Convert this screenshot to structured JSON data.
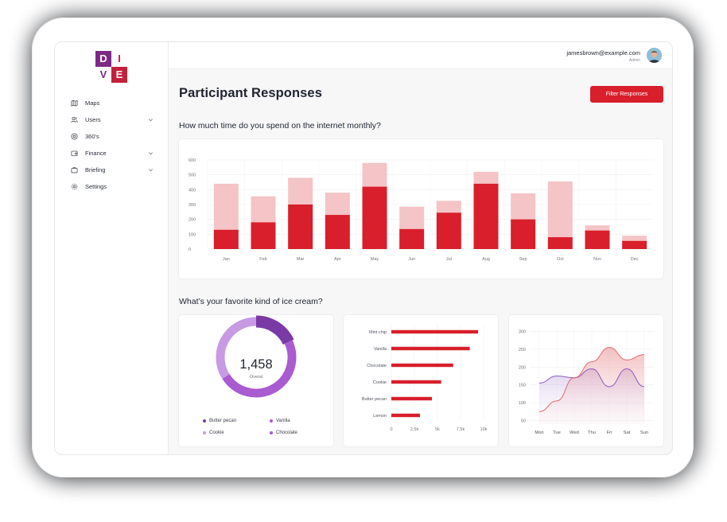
{
  "app": {
    "logo": {
      "letters": [
        "D",
        "I",
        "V",
        "E"
      ]
    }
  },
  "sidebar": {
    "items": [
      {
        "label": "Maps",
        "icon": "map-icon",
        "has_chevron": false
      },
      {
        "label": "Users",
        "icon": "users-icon",
        "has_chevron": true
      },
      {
        "label": "360's",
        "icon": "target-icon",
        "has_chevron": false
      },
      {
        "label": "Finance",
        "icon": "wallet-icon",
        "has_chevron": true
      },
      {
        "label": "Briefing",
        "icon": "briefcase-icon",
        "has_chevron": true
      },
      {
        "label": "Settings",
        "icon": "gear-icon",
        "has_chevron": false
      }
    ]
  },
  "header": {
    "email": "jamesbrown@example.com",
    "role": "Admin"
  },
  "main": {
    "title": "Participant Responses",
    "filter_label": "Filter Responses",
    "question1": "How much time do you spend on the internet monthly?",
    "question2": "What’s your favorite kind of ice cream?"
  },
  "colors": {
    "accent": "#d81f2b",
    "accent_light": "#f4c4c6",
    "purple_dark": "#7a3aa6",
    "purple_mid": "#a95bd0",
    "purple_light": "#c79ae3",
    "line_red": "#e06a70",
    "line_purple": "#8c5cb8"
  },
  "chart_data": [
    {
      "type": "bar",
      "stacked": true,
      "categories": [
        "Jan",
        "Feb",
        "Mar",
        "Apr",
        "May",
        "Jun",
        "Jul",
        "Aug",
        "Sep",
        "Oct",
        "Nov",
        "Dec"
      ],
      "series": [
        {
          "values": [
            130,
            180,
            300,
            230,
            420,
            135,
            245,
            440,
            200,
            80,
            125,
            55
          ]
        },
        {
          "values": [
            310,
            175,
            180,
            150,
            160,
            150,
            80,
            80,
            175,
            375,
            35,
            35
          ]
        }
      ],
      "yticks": [
        0,
        100,
        200,
        300,
        400,
        500,
        600
      ],
      "ylim": [
        0,
        600
      ],
      "grid": true
    },
    {
      "type": "pie",
      "donut": true,
      "total": "1,458",
      "center_label": "Overal",
      "slices": [
        {
          "name": "Butter pecan",
          "value": 18
        },
        {
          "name": "Vanilla",
          "value": 48
        },
        {
          "name": "Cookie",
          "value": 34
        }
      ],
      "legend": [
        "Butter pecan",
        "Vanilla",
        "Cookie",
        "Chocolate"
      ]
    },
    {
      "type": "bar",
      "orientation": "horizontal",
      "categories": [
        "Mint chip",
        "Vanilla",
        "Chocolate",
        "Cookie",
        "Butter pecan",
        "Lemon"
      ],
      "values": [
        9400,
        8500,
        6700,
        5400,
        4400,
        3100
      ],
      "xticks": [
        "0",
        "2,5k",
        "5k",
        "7,5k",
        "10k"
      ],
      "xlim": [
        0,
        10000
      ],
      "grid": true
    },
    {
      "type": "area",
      "categories": [
        "Mon",
        "Tue",
        "Wed",
        "Thu",
        "Fri",
        "Sat",
        "Sun"
      ],
      "series": [
        {
          "values": [
            75,
            105,
            170,
            215,
            255,
            220,
            235
          ]
        },
        {
          "values": [
            155,
            175,
            170,
            195,
            145,
            195,
            145
          ]
        }
      ],
      "yticks": [
        50,
        100,
        150,
        200,
        250,
        300
      ],
      "ylim": [
        40,
        310
      ],
      "grid": true
    }
  ]
}
